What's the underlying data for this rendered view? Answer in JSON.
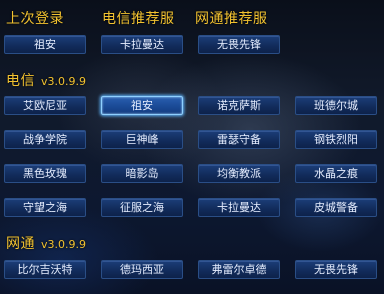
{
  "headers": {
    "recent": "上次登录",
    "telecom_recommend": "电信推荐服",
    "netcom_recommend": "网通推荐服"
  },
  "recent_row": [
    "祖安",
    "卡拉曼达",
    "无畏先锋"
  ],
  "telecom": {
    "label": "电信",
    "version": "v3.0.9.9",
    "servers": [
      "艾欧尼亚",
      "祖安",
      "诺克萨斯",
      "班德尔城",
      "战争学院",
      "巨神峰",
      "雷瑟守备",
      "钢铁烈阳",
      "黑色玫瑰",
      "暗影岛",
      "均衡教派",
      "水晶之痕",
      "守望之海",
      "征服之海",
      "卡拉曼达",
      "皮城警备"
    ]
  },
  "netcom": {
    "label": "网通",
    "version": "v3.0.9.9",
    "servers": [
      "比尔吉沃特",
      "德玛西亚",
      "弗雷尔卓德",
      "无畏先锋"
    ]
  }
}
